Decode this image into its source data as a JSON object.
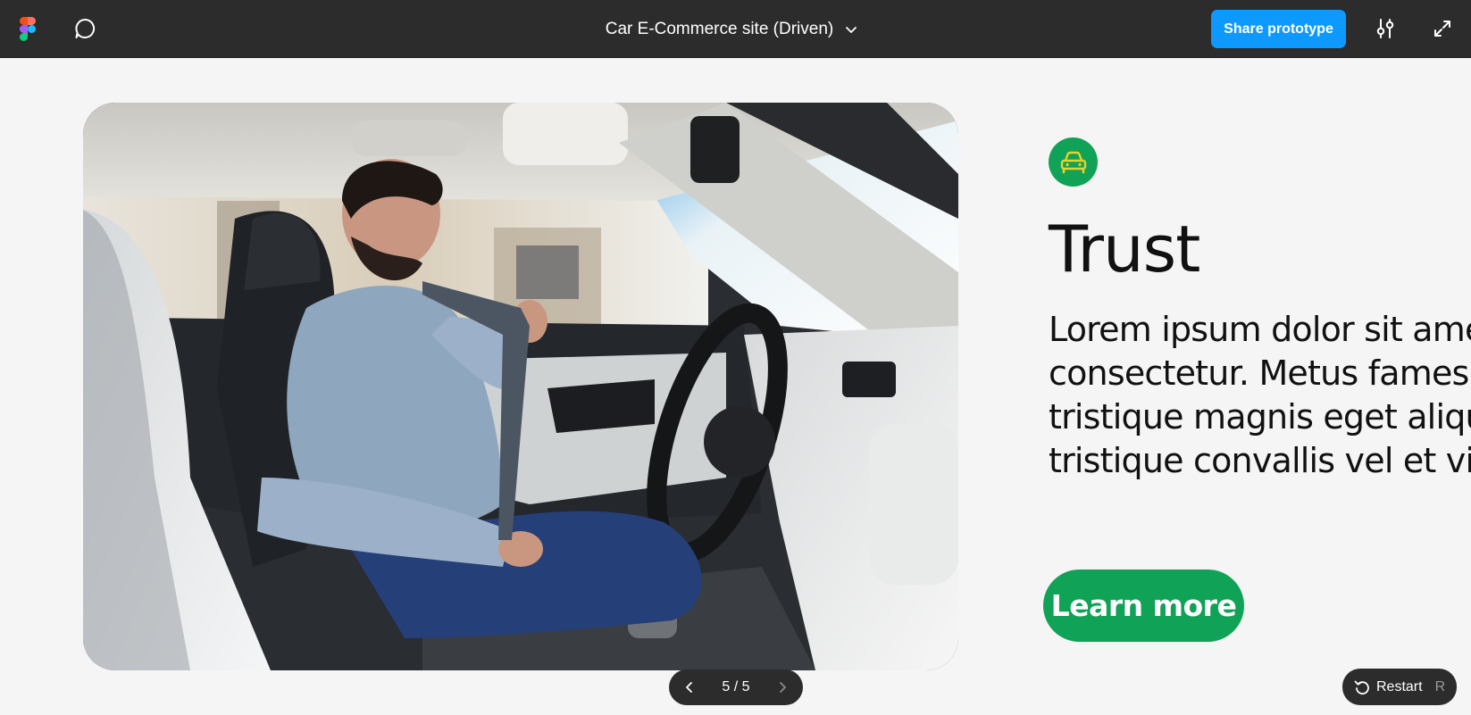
{
  "topbar": {
    "file_title": "Car E-Commerce site (Driven)",
    "share_label": "Share prototype",
    "icons": {
      "logo": "figma-logo-icon",
      "comment": "comment-icon",
      "title_dropdown": "chevron-down-icon",
      "settings": "sliders-icon",
      "expand": "expand-icon"
    },
    "colors": {
      "bar": "#2c2c2c",
      "share": "#0d99ff"
    }
  },
  "frame": {
    "photo_icon": "car-image",
    "badge_icon": "car-icon",
    "heading": "Trust",
    "body": "Lorem ipsum dolor sit amet\nconsectetur. Metus fames n\ntristique magnis eget aliqu\ntristique convallis vel et vita",
    "cta_label": "Learn more",
    "colors": {
      "accent": "#10a256",
      "text": "#111111"
    }
  },
  "pager": {
    "label": "5 / 5",
    "prev_icon": "chevron-left-icon",
    "next_icon": "chevron-right-icon"
  },
  "restart": {
    "label": "Restart",
    "shortcut": "R",
    "icon": "restart-icon"
  }
}
